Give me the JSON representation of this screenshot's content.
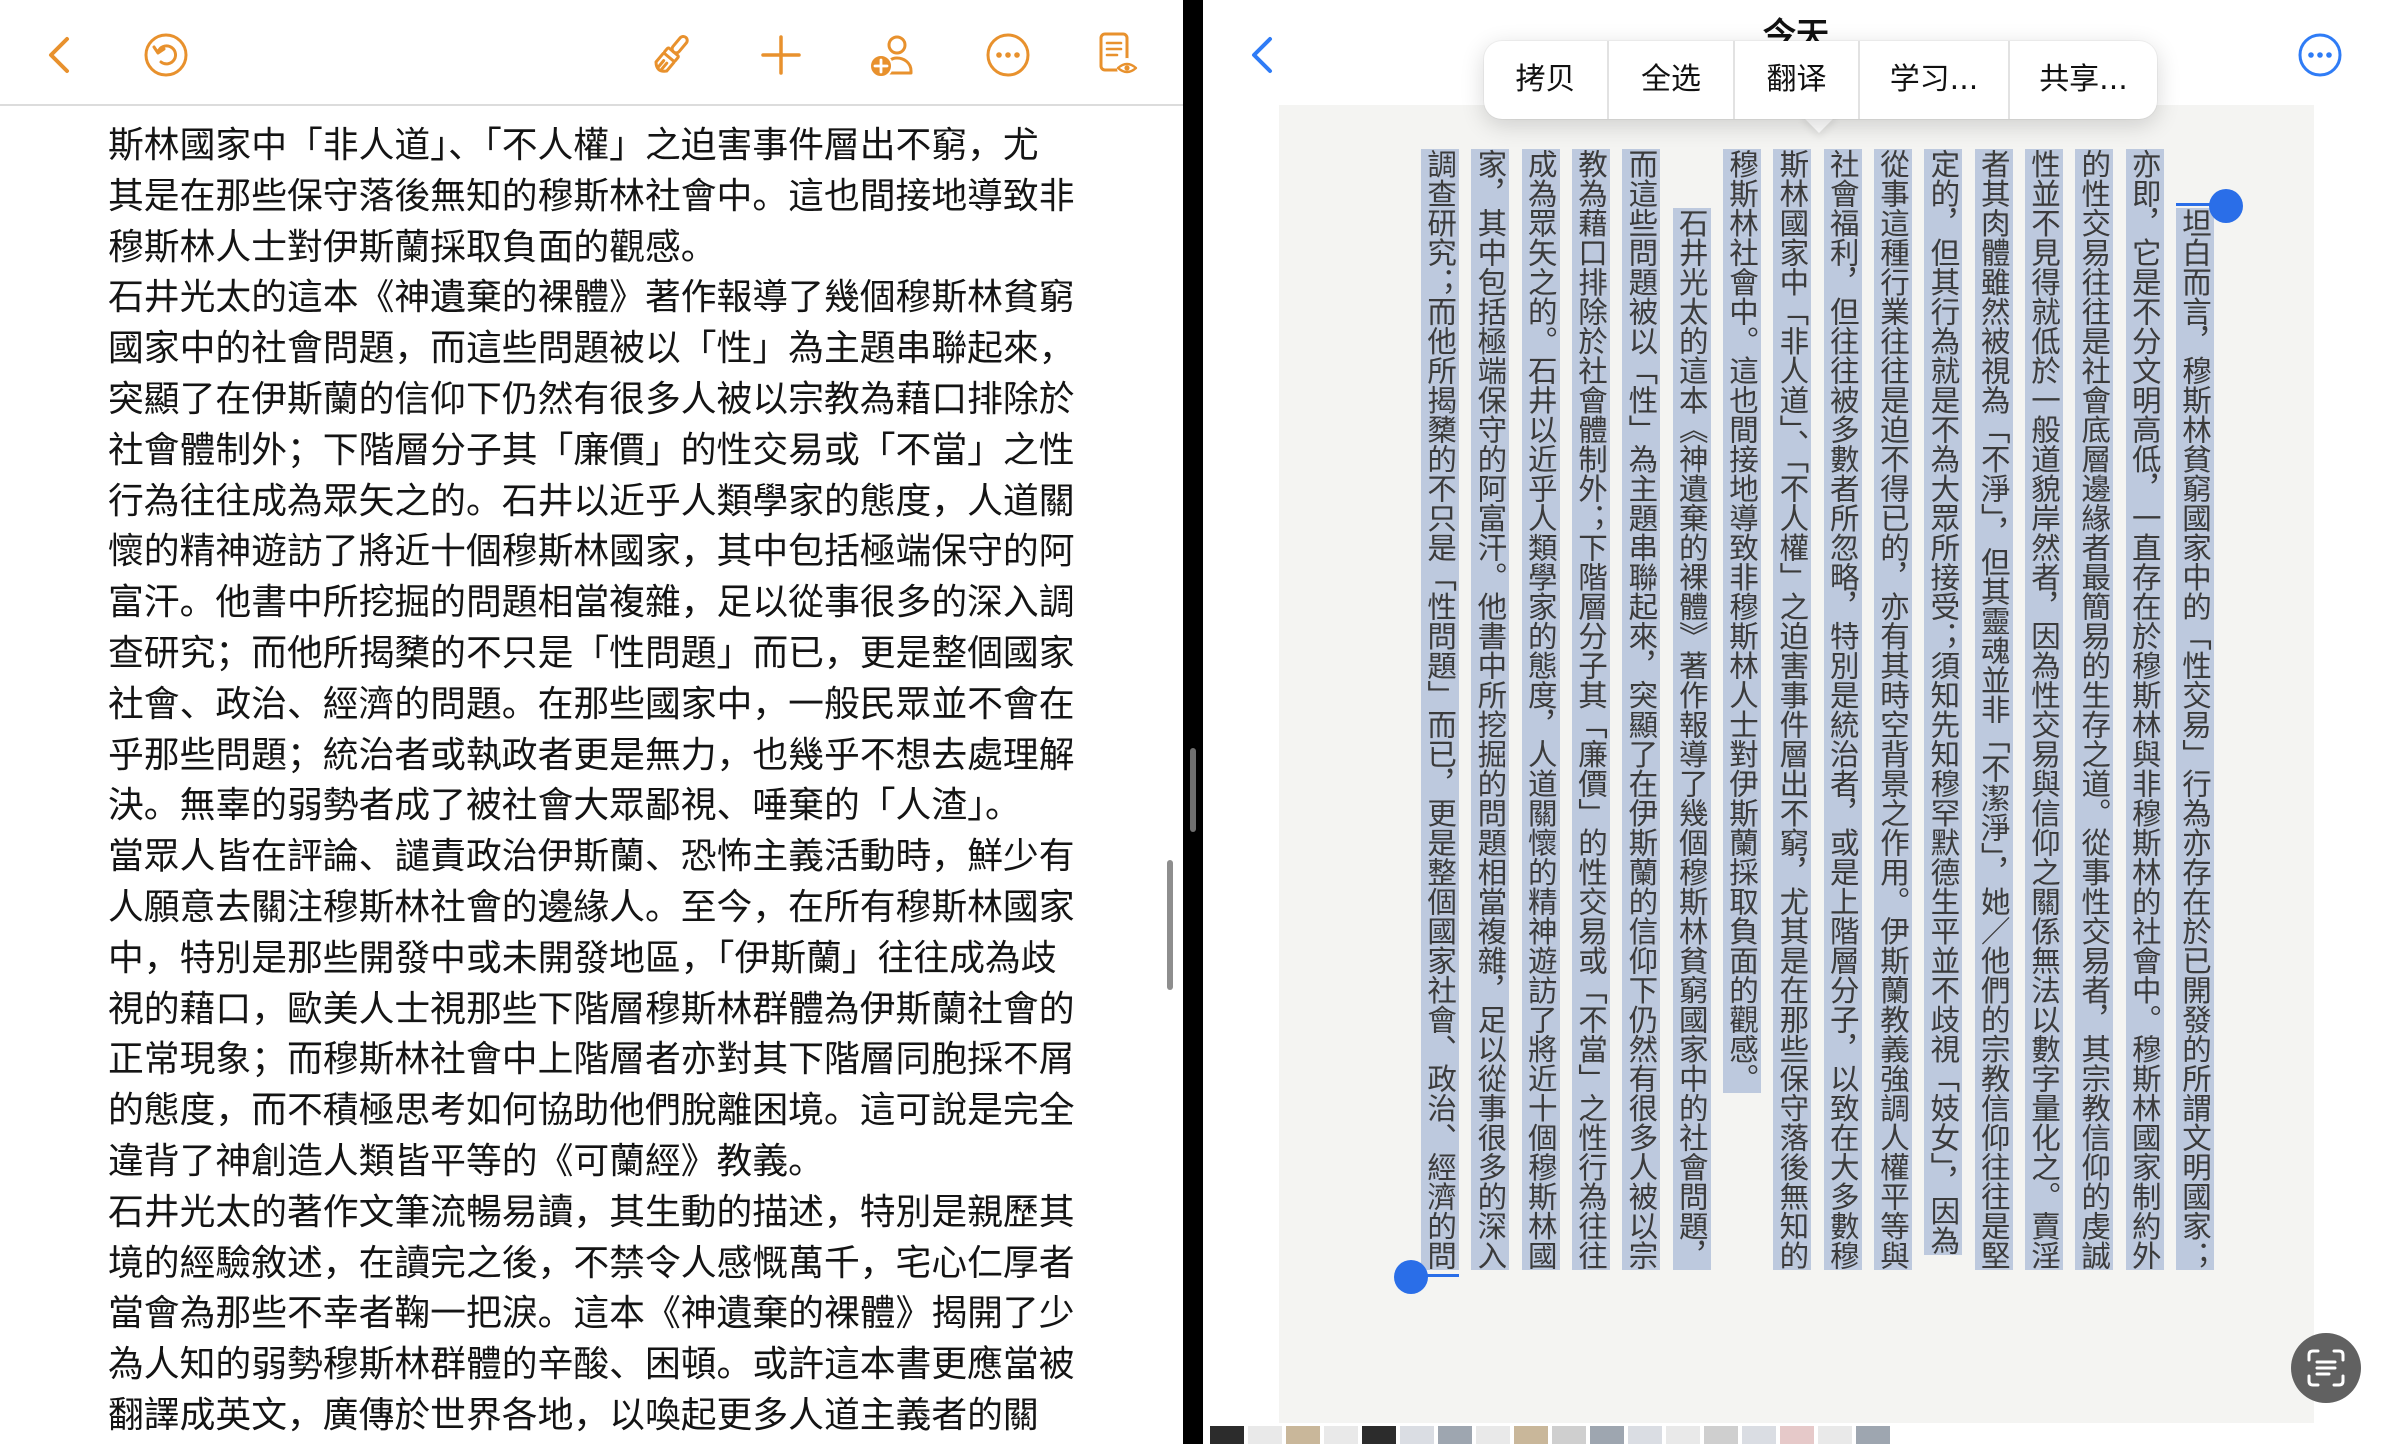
{
  "colors": {
    "left_accent": "#e8912d",
    "right_accent": "#2f7cf6",
    "selection_highlight": "#bdc9de",
    "selection_handle": "#2a6ee8"
  },
  "left_pane": {
    "toolbar_icons": [
      "chevron-left-icon",
      "undo-icon",
      "paintbrush-icon",
      "plus-icon",
      "collaborate-icon",
      "more-icon",
      "document-view-icon"
    ],
    "lines": [
      "斯林國家中「非人道」、「不人權」之迫害事件層出不窮，尤",
      "其是在那些保守落後無知的穆斯林社會中。這也間接地導致非",
      "穆斯林人士對伊斯蘭採取負面的觀感。",
      "石井光太的這本《神遺棄的裸體》著作報導了幾個穆斯林貧窮",
      "國家中的社會問題，而這些問題被以「性」為主題串聯起來，",
      "突顯了在伊斯蘭的信仰下仍然有很多人被以宗教為藉口排除於",
      "社會體制外；下階層分子其「廉價」的性交易或「不當」之性",
      "行為往往成為眾矢之的。石井以近乎人類學家的態度，人道關",
      "懷的精神遊訪了將近十個穆斯林國家，其中包括極端保守的阿",
      "富汗。他書中所挖掘的問題相當複雜，足以從事很多的深入調",
      "查研究；而他所揭櫫的不只是「性問題」而已，更是整個國家",
      "社會、政治、經濟的問題。在那些國家中，一般民眾並不會在",
      "乎那些問題；統治者或執政者更是無力，也幾乎不想去處理解",
      "決。無辜的弱勢者成了被社會大眾鄙視、唾棄的「人渣」。",
      "當眾人皆在評論、譴責政治伊斯蘭、恐怖主義活動時，鮮少有",
      "人願意去關注穆斯林社會的邊緣人。至今，在所有穆斯林國家",
      "中，特別是那些開發中或未開發地區，「伊斯蘭」往往成為歧",
      "視的藉口，歐美人士視那些下階層穆斯林群體為伊斯蘭社會的",
      "正常現象；而穆斯林社會中上階層者亦對其下階層同胞採不屑",
      "的態度，而不積極思考如何協助他們脫離困境。這可說是完全",
      "違背了神創造人類皆平等的《可蘭經》教義。",
      "石井光太的著作文筆流暢易讀，其生動的描述，特別是親歷其",
      "境的經驗敘述，在讀完之後，不禁令人感慨萬千，宅心仁厚者",
      "當會為那些不幸者鞠一把淚。這本《神遺棄的裸體》揭開了少",
      "為人知的弱勢穆斯林群體的辛酸、困頓。或許這本書更應當被",
      "翻譯成英文，廣傳於世界各地，以喚起更多人道主義者的關"
    ]
  },
  "right_pane": {
    "title": "今天",
    "toolbar_icons": [
      "chevron-left-icon",
      "more-icon"
    ],
    "selection_menu": [
      "拷贝",
      "全选",
      "翻译",
      "学习...",
      "共享..."
    ],
    "photo_text_columns": [
      "坦白而言，穆斯林貧窮國家中的「性交易」行為亦存在於已開發的所謂文明國家；",
      "亦即，它是不分文明高低，一直存在於穆斯林與非穆斯林的社會中。穆斯林國家制約外",
      "的性交易往往是社會底層邊緣者最簡易的生存之道。從事性交易者，其宗教信仰的虔誠",
      "性並不見得就低於一般道貌岸然者，因為性交易與信仰之關係無法以數字量化之。賣淫",
      "者其肉體雖然被視為「不淨」，但其靈魂並非「不潔淨」，她／他們的宗教信仰往往是堅",
      "定的，但其行為就是不為大眾所接受；須知先知穆罕默德生平並不歧視「妓女」，因為",
      "從事這種行業往往是迫不得已的，亦有其時空背景之作用。伊斯蘭教義強調人權平等與",
      "社會福利，但往往被多數者所忽略，特別是統治者，或是上階層分子，以致在大多數穆",
      "斯林國家中「非人道」、「不人權」之迫害事件層出不窮，尤其是在那些保守落後無知的",
      "穆斯林社會中。這也間接地導致非穆斯林人士對伊斯蘭採取負面的觀感。",
      "石井光太的這本《神遺棄的裸體》著作報導了幾個穆斯林貧窮國家中的社會問題，",
      "而這些問題被以「性」為主題串聯起來，突顯了在伊斯蘭的信仰下仍然有很多人被以宗",
      "教為藉口排除於社會體制外；下階層分子其「廉價」的性交易或「不當」之性行為往往",
      "成為眾矢之的。石井以近乎人類學家的態度，人道關懷的精神遊訪了將近十個穆斯林國",
      "家，其中包括極端保守的阿富汗。他書中所挖掘的問題相當複雜，足以從事很多的深入",
      "調查研究；而他所揭櫫的不只是「性問題」而已，更是整個國家社會、政治、經濟的問"
    ],
    "live_text_button_icon": "live-text-icon"
  }
}
